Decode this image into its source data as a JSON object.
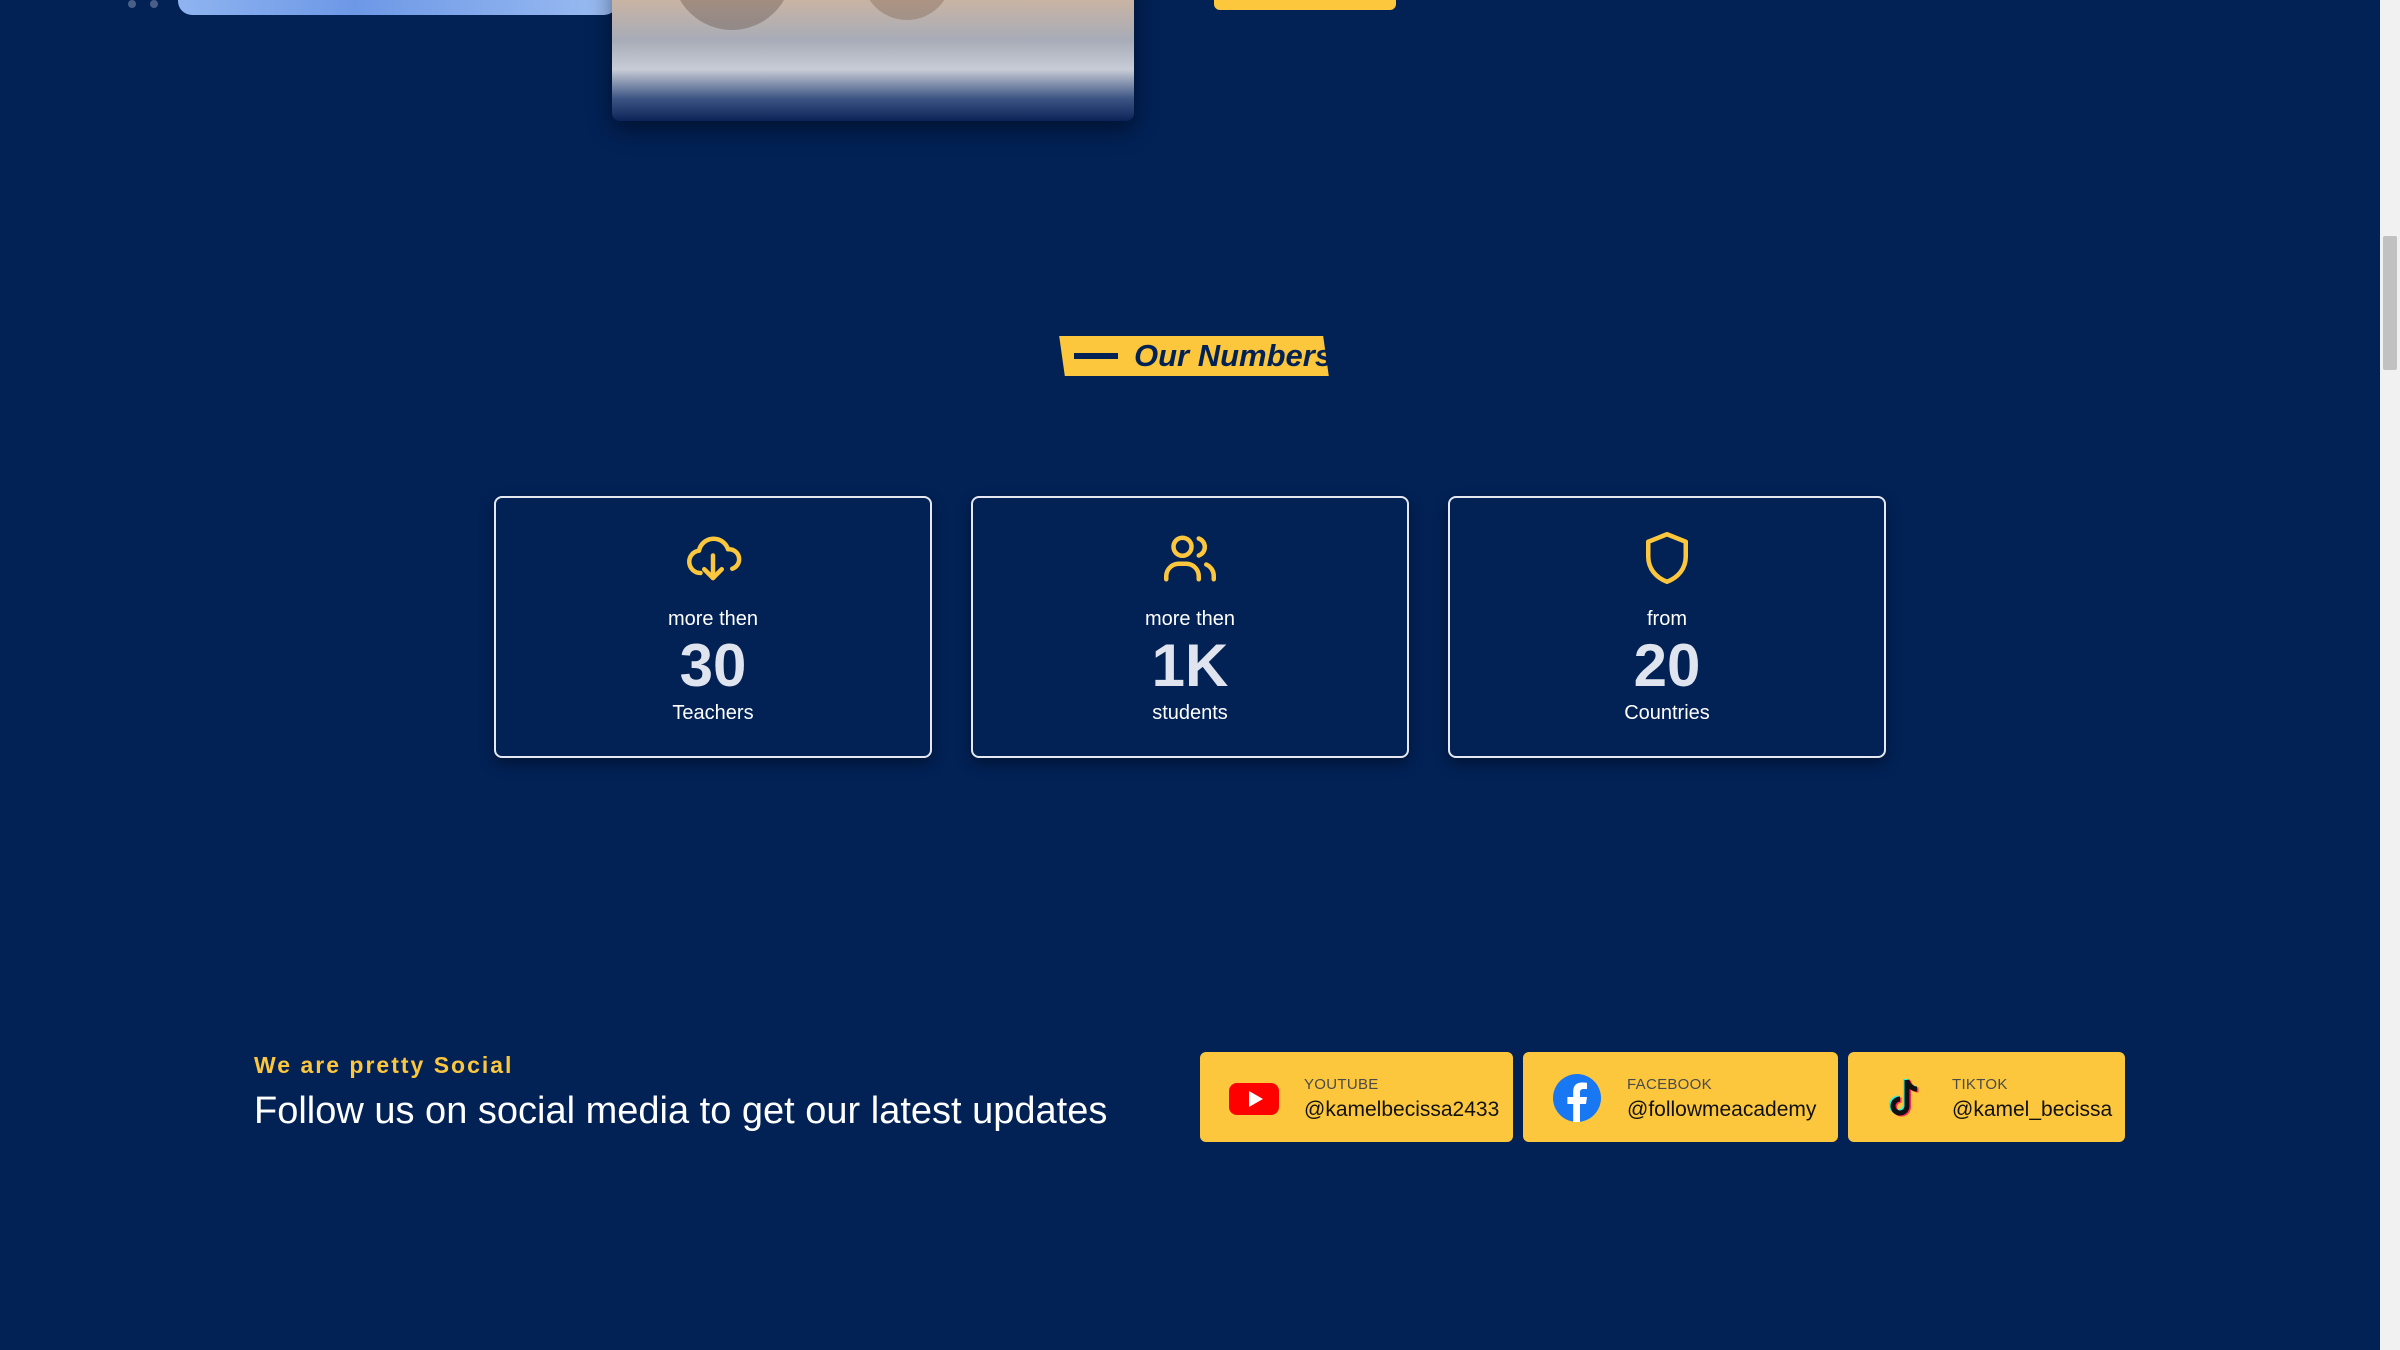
{
  "numbers_section": {
    "title": "Our Numbers",
    "stats": [
      {
        "icon": "cloud-download-icon",
        "prefix": "more then",
        "value": "30",
        "label": "Teachers"
      },
      {
        "icon": "users-icon",
        "prefix": "more then",
        "value": "1K",
        "label": "students"
      },
      {
        "icon": "shield-icon",
        "prefix": "from",
        "value": "20",
        "label": "Countries"
      }
    ]
  },
  "social_section": {
    "eyebrow": "We are pretty Social",
    "heading": "Follow us on social media to get our latest updates",
    "links": [
      {
        "icon": "youtube-icon",
        "platform": "YOUTUBE",
        "handle": "@kamelbecissa2433"
      },
      {
        "icon": "facebook-icon",
        "platform": "FACEBOOK",
        "handle": "@followmeacademy"
      },
      {
        "icon": "tiktok-icon",
        "platform": "TIKTOK",
        "handle": "@kamel_becissa"
      }
    ]
  },
  "colors": {
    "background": "#022155",
    "accent": "#fcc73d",
    "card_border": "#e5e8f0"
  }
}
